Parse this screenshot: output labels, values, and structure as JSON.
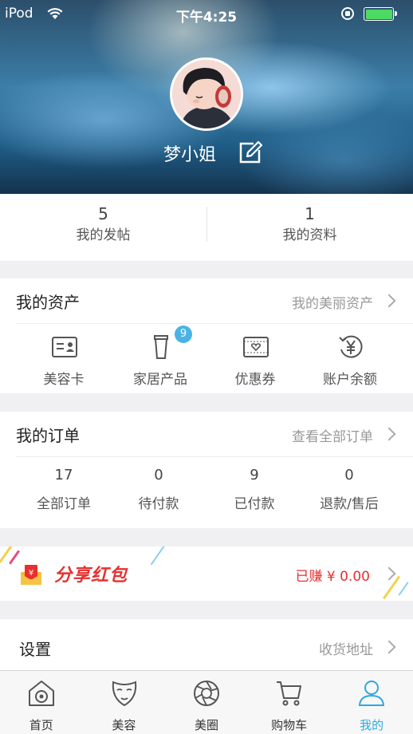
{
  "status_bar": {
    "carrier": "iPod",
    "time": "下午4:25"
  },
  "profile": {
    "name": "梦小姐"
  },
  "stats": [
    {
      "value": "5",
      "label": "我的发帖"
    },
    {
      "value": "1",
      "label": "我的资料"
    }
  ],
  "assets": {
    "title": "我的资产",
    "link": "我的美丽资产",
    "items": [
      {
        "label": "美容卡",
        "icon": "card-icon"
      },
      {
        "label": "家居产品",
        "icon": "cup-icon",
        "badge": "9"
      },
      {
        "label": "优惠券",
        "icon": "coupon-icon"
      },
      {
        "label": "账户余额",
        "icon": "yen-icon"
      }
    ]
  },
  "orders": {
    "title": "我的订单",
    "link": "查看全部订单",
    "items": [
      {
        "count": "17",
        "label": "全部订单"
      },
      {
        "count": "0",
        "label": "待付款"
      },
      {
        "count": "9",
        "label": "已付款"
      },
      {
        "count": "0",
        "label": "退款/售后"
      }
    ]
  },
  "share": {
    "title": "分享红包",
    "earned": "已赚 ¥ 0.00"
  },
  "settings": {
    "title": "设置",
    "link": "收货地址"
  },
  "tabs": [
    {
      "label": "首页",
      "icon": "home-icon"
    },
    {
      "label": "美容",
      "icon": "face-mask-icon"
    },
    {
      "label": "美圈",
      "icon": "aperture-icon"
    },
    {
      "label": "购物车",
      "icon": "cart-icon"
    },
    {
      "label": "我的",
      "icon": "user-icon",
      "active": true
    }
  ],
  "colors": {
    "accent": "#2fa9dc",
    "red": "#e53030",
    "badge": "#4ab3e6",
    "battery": "#4cd964"
  }
}
